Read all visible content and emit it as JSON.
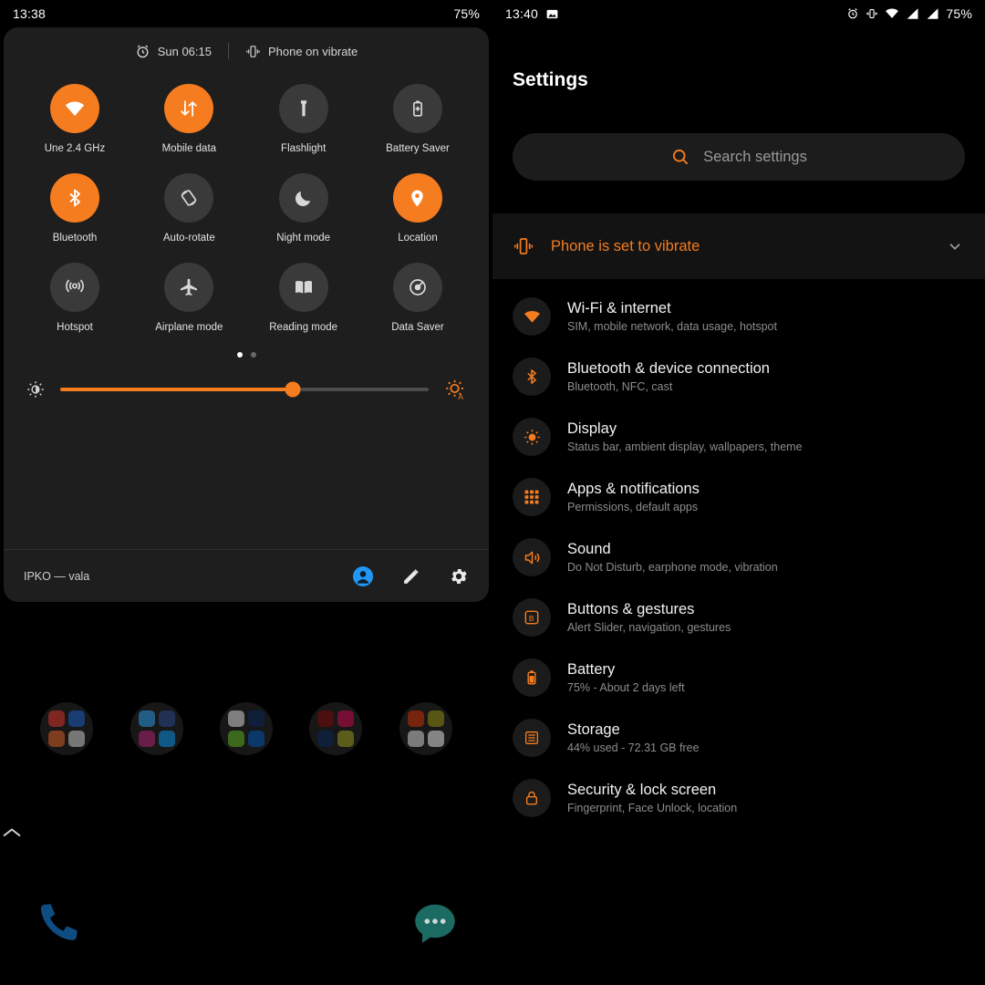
{
  "accent": "#f57c1f",
  "left": {
    "statusbar": {
      "time": "13:38",
      "battery": "75%"
    },
    "shade_header": {
      "alarm": "Sun 06:15",
      "ringer": "Phone on vibrate"
    },
    "tiles": [
      {
        "label": "Une 2.4 GHz",
        "icon": "wifi-icon",
        "on": true
      },
      {
        "label": "Mobile data",
        "icon": "mobile-data-icon",
        "on": true
      },
      {
        "label": "Flashlight",
        "icon": "flashlight-icon",
        "on": false
      },
      {
        "label": "Battery Saver",
        "icon": "battery-saver-icon",
        "on": false
      },
      {
        "label": "Bluetooth",
        "icon": "bluetooth-icon",
        "on": true
      },
      {
        "label": "Auto-rotate",
        "icon": "auto-rotate-icon",
        "on": false
      },
      {
        "label": "Night mode",
        "icon": "moon-icon",
        "on": false
      },
      {
        "label": "Location",
        "icon": "location-pin-icon",
        "on": true
      },
      {
        "label": "Hotspot",
        "icon": "hotspot-icon",
        "on": false
      },
      {
        "label": "Airplane mode",
        "icon": "airplane-icon",
        "on": false
      },
      {
        "label": "Reading mode",
        "icon": "reading-mode-icon",
        "on": false
      },
      {
        "label": "Data Saver",
        "icon": "data-saver-icon",
        "on": false
      }
    ],
    "pages": {
      "count": 2,
      "active": 1
    },
    "brightness": {
      "percent": 63
    },
    "footer": {
      "carrier": "IPKO — vala"
    }
  },
  "right": {
    "statusbar": {
      "time": "13:40",
      "battery": "75%"
    },
    "title": "Settings",
    "search": {
      "placeholder": "Search settings"
    },
    "banner": {
      "text": "Phone is set to vibrate"
    },
    "items": [
      {
        "title": "Wi-Fi & internet",
        "sub": "SIM, mobile network, data usage, hotspot",
        "icon": "wifi-icon"
      },
      {
        "title": "Bluetooth & device connection",
        "sub": "Bluetooth, NFC, cast",
        "icon": "bluetooth-icon"
      },
      {
        "title": "Display",
        "sub": "Status bar, ambient display, wallpapers, theme",
        "icon": "brightness-icon"
      },
      {
        "title": "Apps & notifications",
        "sub": "Permissions, default apps",
        "icon": "apps-grid-icon"
      },
      {
        "title": "Sound",
        "sub": "Do Not Disturb, earphone mode, vibration",
        "icon": "speaker-icon"
      },
      {
        "title": "Buttons & gestures",
        "sub": "Alert Slider, navigation, gestures",
        "icon": "buttons-icon"
      },
      {
        "title": "Battery",
        "sub": "75% - About 2 days left",
        "icon": "battery-icon"
      },
      {
        "title": "Storage",
        "sub": "44% used - 72.31 GB free",
        "icon": "storage-icon"
      },
      {
        "title": "Security & lock screen",
        "sub": "Fingerprint, Face Unlock, location",
        "icon": "lock-icon"
      }
    ]
  }
}
